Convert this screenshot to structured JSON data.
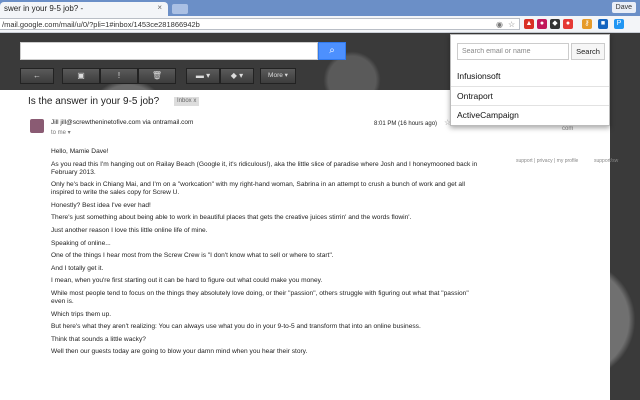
{
  "browser": {
    "tab_title": "swer in your 9-5 job? -",
    "tab_close": "×",
    "user_name": "Dave",
    "url": "/mail.google.com/mail/u/0/?pli=1#inbox/1453ce281866942b",
    "extensions": [
      {
        "name": "extension-red-icon",
        "color": "#d93025"
      },
      {
        "name": "extension-pink-icon",
        "color": "#c2185b"
      },
      {
        "name": "extension-dark-icon",
        "color": "#333333"
      },
      {
        "name": "extension-red2-icon",
        "color": "#e53935"
      },
      {
        "name": "extension-key-icon",
        "color": "#e69b2a"
      },
      {
        "name": "extension-blue-icon",
        "color": "#1565c0"
      },
      {
        "name": "extension-lightblue-icon",
        "color": "#2196f3"
      }
    ]
  },
  "gmail": {
    "toolbar": {
      "more_label": "More ▾"
    },
    "message": {
      "subject": "Is the answer in your 9-5 job?",
      "label": "Inbox x",
      "sender": "Jill jill@screwtheninetofive.com via ontramail.com",
      "to": "to me ▾",
      "date": "8:01 PM (16 hours ago)",
      "body": [
        "Hello, Mamie Dave!",
        "As you read this I'm hanging out on Railay Beach (Google it, it's ridiculous!), aka the little slice of paradise where Josh and I honeymooned back in February 2013.",
        "Only he's back in Chiang Mai, and I'm on a \"workcation\" with my right-hand woman, Sabrina in an attempt to crush a bunch of work and get all inspired to write the sales copy for Screw U.",
        "Honestly? Best idea I've ever had!",
        "There's just something about being able to work in beautiful places that gets the creative juices stirrin' and the words flowin'.",
        "Just another reason I love this little online life of mine.",
        "Speaking of online...",
        "One of the things I hear most from the Screw Crew is \"I don't know what to sell or where to start\".",
        "And I totally get it.",
        "I mean, when you're first starting out it can be hard to figure out what could make you money.",
        "While most people tend to focus on the things they absolutely love doing, or their \"passion\", others struggle with figuring out what that \"passion\" even is.",
        "Which trips them up.",
        "But here's what they aren't realizing: You can always use what you do in your 9-to-5 and transform that into an online business.",
        "Think that sounds a little wacky?",
        "Well then our guests today are going to blow your damn mind when you hear their story."
      ]
    },
    "side": {
      "com": "com",
      "links": "support | privacy | my profile",
      "support": "support/sw"
    }
  },
  "popup": {
    "placeholder": "Search email or name",
    "search_label": "Search",
    "items": [
      "Infusionsoft",
      "Ontraport",
      "ActiveCampaign"
    ]
  }
}
